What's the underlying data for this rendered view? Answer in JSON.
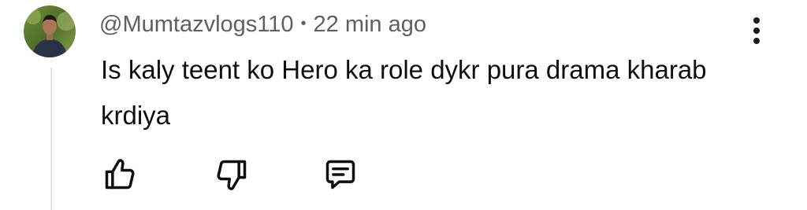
{
  "comment": {
    "author": "@Mumtazvlogs110",
    "separator": "•",
    "time": "22 min ago",
    "text": "Is kaly teent ko Hero ka role dykr pura drama kharab krdiya"
  },
  "icons": {
    "more": "more-vert-icon",
    "like": "thumb-up-icon",
    "dislike": "thumb-down-icon",
    "reply": "reply-comment-icon"
  },
  "colors": {
    "meta_text": "#606060",
    "body_text": "#0f0f0f",
    "icon": "#0f0f0f",
    "thread_line": "#e3e3e3"
  }
}
